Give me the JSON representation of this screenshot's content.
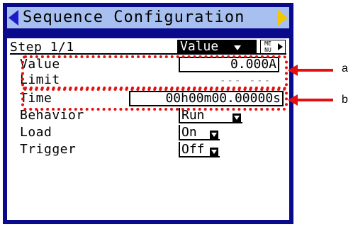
{
  "title": "Sequence Configuration",
  "header": {
    "step": "Step 1/1",
    "tab": "Value",
    "menu": "ME\nNU"
  },
  "rows": {
    "value": {
      "label": "Value",
      "field": "0.000A"
    },
    "limit": {
      "label": "Limit",
      "field": "--- ---"
    },
    "time": {
      "label": "Time",
      "field": "00h00m00.00000s"
    },
    "behavior": {
      "label": "Behavior",
      "field": "Run"
    },
    "load": {
      "label": "Load",
      "field": "On"
    },
    "trigger": {
      "label": "Trigger",
      "field": "Off"
    }
  },
  "annotations": {
    "a": "a",
    "b": "b"
  },
  "colors": {
    "screen": "#0a0a8c",
    "titlebar": "#a8c0f0",
    "annotation": "#e41010"
  }
}
